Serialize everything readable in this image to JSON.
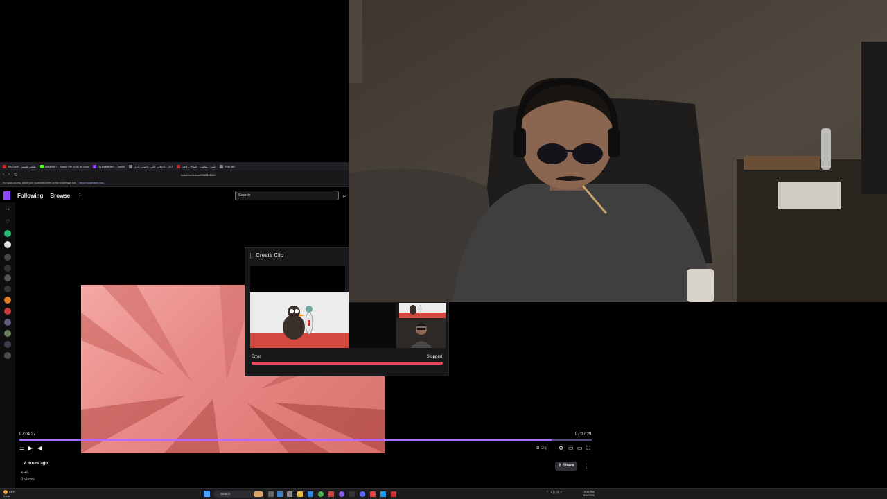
{
  "browser": {
    "tabs": [
      {
        "label": "YouTube - طالبي الشعر",
        "color": "#cc2b2b"
      },
      {
        "label": "abearme7 - Watch the VOD on Kick",
        "color": "#53fc18"
      },
      {
        "label": "(1) Abearme7 - Twitch",
        "color": "#9147ff"
      },
      {
        "label": "اجار - الاعلاني على... كلوني رابرل",
        "color": "#888888"
      },
      {
        "label": "يامي - بيطوب - المتاح... لاحب",
        "color": "#cc2b2b"
      },
      {
        "label": "New tab",
        "color": "#888888"
      }
    ],
    "url": "twitch.tv/videos/2340328963",
    "bookmark_text": "For quick access, place your bookmarks here on the bookmarks bar.",
    "bookmark_link": "Import bookmarks now..."
  },
  "twitch": {
    "nav": {
      "following": "Following",
      "browse": "Browse",
      "more": "⋮"
    },
    "search": {
      "placeholder": "Search",
      "icon": "⌕"
    }
  },
  "player": {
    "time_current": "07:04:27",
    "time_total": "07:37:29",
    "progress_fraction": 0.93,
    "clip_label": "Clip",
    "icons": {
      "list": "☰",
      "play": "▶",
      "mute": "◀",
      "settings": "⚙",
      "theatre": "▭",
      "fullscreen": "⛶"
    }
  },
  "video_info": {
    "age": "8 hours ago",
    "title": "يلعنة",
    "views": "0 views",
    "share": "Share",
    "more": "⋮"
  },
  "clip_window": {
    "title": "Create Clip",
    "drag_icon": "⣿",
    "status_left": "Error",
    "status_right": "Stopped",
    "bar_color": "#e8485b"
  },
  "taskbar": {
    "weather_temp": "44°F",
    "weather_desc": "Clear",
    "search_placeholder": "Search",
    "time": "3:18 PM",
    "date": "8/8/2026",
    "tray": "⌃ ◔ ▯ ⊡ ♫"
  }
}
